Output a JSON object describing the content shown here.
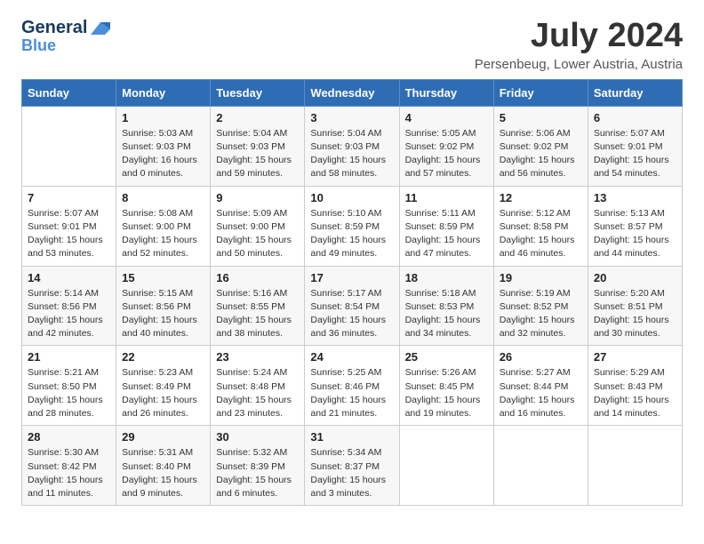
{
  "logo": {
    "line1": "General",
    "line2": "Blue"
  },
  "title": "July 2024",
  "subtitle": "Persenbeug, Lower Austria, Austria",
  "days_of_week": [
    "Sunday",
    "Monday",
    "Tuesday",
    "Wednesday",
    "Thursday",
    "Friday",
    "Saturday"
  ],
  "weeks": [
    [
      {
        "num": "",
        "data": ""
      },
      {
        "num": "1",
        "data": "Sunrise: 5:03 AM\nSunset: 9:03 PM\nDaylight: 16 hours\nand 0 minutes."
      },
      {
        "num": "2",
        "data": "Sunrise: 5:04 AM\nSunset: 9:03 PM\nDaylight: 15 hours\nand 59 minutes."
      },
      {
        "num": "3",
        "data": "Sunrise: 5:04 AM\nSunset: 9:03 PM\nDaylight: 15 hours\nand 58 minutes."
      },
      {
        "num": "4",
        "data": "Sunrise: 5:05 AM\nSunset: 9:02 PM\nDaylight: 15 hours\nand 57 minutes."
      },
      {
        "num": "5",
        "data": "Sunrise: 5:06 AM\nSunset: 9:02 PM\nDaylight: 15 hours\nand 56 minutes."
      },
      {
        "num": "6",
        "data": "Sunrise: 5:07 AM\nSunset: 9:01 PM\nDaylight: 15 hours\nand 54 minutes."
      }
    ],
    [
      {
        "num": "7",
        "data": "Sunrise: 5:07 AM\nSunset: 9:01 PM\nDaylight: 15 hours\nand 53 minutes."
      },
      {
        "num": "8",
        "data": "Sunrise: 5:08 AM\nSunset: 9:00 PM\nDaylight: 15 hours\nand 52 minutes."
      },
      {
        "num": "9",
        "data": "Sunrise: 5:09 AM\nSunset: 9:00 PM\nDaylight: 15 hours\nand 50 minutes."
      },
      {
        "num": "10",
        "data": "Sunrise: 5:10 AM\nSunset: 8:59 PM\nDaylight: 15 hours\nand 49 minutes."
      },
      {
        "num": "11",
        "data": "Sunrise: 5:11 AM\nSunset: 8:59 PM\nDaylight: 15 hours\nand 47 minutes."
      },
      {
        "num": "12",
        "data": "Sunrise: 5:12 AM\nSunset: 8:58 PM\nDaylight: 15 hours\nand 46 minutes."
      },
      {
        "num": "13",
        "data": "Sunrise: 5:13 AM\nSunset: 8:57 PM\nDaylight: 15 hours\nand 44 minutes."
      }
    ],
    [
      {
        "num": "14",
        "data": "Sunrise: 5:14 AM\nSunset: 8:56 PM\nDaylight: 15 hours\nand 42 minutes."
      },
      {
        "num": "15",
        "data": "Sunrise: 5:15 AM\nSunset: 8:56 PM\nDaylight: 15 hours\nand 40 minutes."
      },
      {
        "num": "16",
        "data": "Sunrise: 5:16 AM\nSunset: 8:55 PM\nDaylight: 15 hours\nand 38 minutes."
      },
      {
        "num": "17",
        "data": "Sunrise: 5:17 AM\nSunset: 8:54 PM\nDaylight: 15 hours\nand 36 minutes."
      },
      {
        "num": "18",
        "data": "Sunrise: 5:18 AM\nSunset: 8:53 PM\nDaylight: 15 hours\nand 34 minutes."
      },
      {
        "num": "19",
        "data": "Sunrise: 5:19 AM\nSunset: 8:52 PM\nDaylight: 15 hours\nand 32 minutes."
      },
      {
        "num": "20",
        "data": "Sunrise: 5:20 AM\nSunset: 8:51 PM\nDaylight: 15 hours\nand 30 minutes."
      }
    ],
    [
      {
        "num": "21",
        "data": "Sunrise: 5:21 AM\nSunset: 8:50 PM\nDaylight: 15 hours\nand 28 minutes."
      },
      {
        "num": "22",
        "data": "Sunrise: 5:23 AM\nSunset: 8:49 PM\nDaylight: 15 hours\nand 26 minutes."
      },
      {
        "num": "23",
        "data": "Sunrise: 5:24 AM\nSunset: 8:48 PM\nDaylight: 15 hours\nand 23 minutes."
      },
      {
        "num": "24",
        "data": "Sunrise: 5:25 AM\nSunset: 8:46 PM\nDaylight: 15 hours\nand 21 minutes."
      },
      {
        "num": "25",
        "data": "Sunrise: 5:26 AM\nSunset: 8:45 PM\nDaylight: 15 hours\nand 19 minutes."
      },
      {
        "num": "26",
        "data": "Sunrise: 5:27 AM\nSunset: 8:44 PM\nDaylight: 15 hours\nand 16 minutes."
      },
      {
        "num": "27",
        "data": "Sunrise: 5:29 AM\nSunset: 8:43 PM\nDaylight: 15 hours\nand 14 minutes."
      }
    ],
    [
      {
        "num": "28",
        "data": "Sunrise: 5:30 AM\nSunset: 8:42 PM\nDaylight: 15 hours\nand 11 minutes."
      },
      {
        "num": "29",
        "data": "Sunrise: 5:31 AM\nSunset: 8:40 PM\nDaylight: 15 hours\nand 9 minutes."
      },
      {
        "num": "30",
        "data": "Sunrise: 5:32 AM\nSunset: 8:39 PM\nDaylight: 15 hours\nand 6 minutes."
      },
      {
        "num": "31",
        "data": "Sunrise: 5:34 AM\nSunset: 8:37 PM\nDaylight: 15 hours\nand 3 minutes."
      },
      {
        "num": "",
        "data": ""
      },
      {
        "num": "",
        "data": ""
      },
      {
        "num": "",
        "data": ""
      }
    ]
  ]
}
